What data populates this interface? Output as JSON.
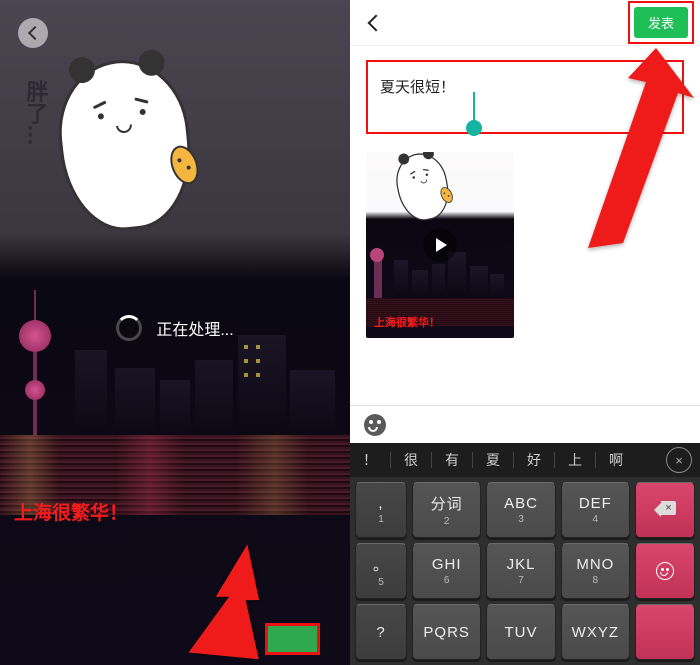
{
  "left": {
    "sticker_text": "胖了…",
    "loading_text": "正在处理...",
    "caption": "上海很繁华！"
  },
  "right": {
    "publish_label": "发表",
    "input_text": "夏天很短！",
    "thumbnail_caption": "上海很繁华！",
    "suggestions": [
      "！",
      "很",
      "有",
      "夏",
      "好",
      "上",
      "啊"
    ],
    "keys": {
      "r1c1": ",",
      "r1c1_sub": "1",
      "r1c2": "分词",
      "r1c2_sub": "2",
      "r1c3": "ABC",
      "r1c3_sub": "3",
      "r1c4": "DEF",
      "r1c4_sub": "4",
      "r2c1": "。",
      "r2c1_sub": "5",
      "r2c2": "GHI",
      "r2c2_sub": "6",
      "r2c3": "JKL",
      "r2c3_sub": "7",
      "r2c4": "MNO",
      "r2c4_sub": "8",
      "r3c1": "?",
      "r3c1_sub": "",
      "r3c2": "PQRS",
      "r3c2_sub": "",
      "r3c3": "TUV",
      "r3c3_sub": "",
      "r3c4": "WXYZ",
      "r3c4_sub": ""
    }
  }
}
